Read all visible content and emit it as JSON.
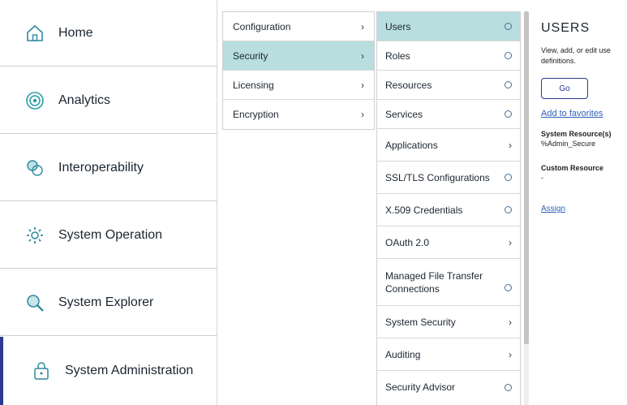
{
  "nav": {
    "items": [
      {
        "label": "Home",
        "icon": "home-icon"
      },
      {
        "label": "Analytics",
        "icon": "analytics-icon"
      },
      {
        "label": "Interoperability",
        "icon": "interoperability-icon"
      },
      {
        "label": "System Operation",
        "icon": "system-operation-icon"
      },
      {
        "label": "System Explorer",
        "icon": "system-explorer-icon"
      },
      {
        "label": "System Administration",
        "icon": "system-administration-icon",
        "active": true
      }
    ],
    "accent": "#2c3b8f"
  },
  "column1": {
    "items": [
      {
        "label": "Configuration"
      },
      {
        "label": "Security",
        "selected": true
      },
      {
        "label": "Licensing"
      },
      {
        "label": "Encryption"
      }
    ]
  },
  "column2": {
    "items": [
      {
        "label": "Users",
        "indicator": "circle",
        "selected": true
      },
      {
        "label": "Roles",
        "indicator": "circle"
      },
      {
        "label": "Resources",
        "indicator": "circle"
      },
      {
        "label": "Services",
        "indicator": "circle"
      },
      {
        "label": "Applications",
        "indicator": "chevron"
      },
      {
        "label": "SSL/TLS Configurations",
        "indicator": "circle"
      },
      {
        "label": "X.509 Credentials",
        "indicator": "circle"
      },
      {
        "label": "OAuth 2.0",
        "indicator": "chevron"
      },
      {
        "label": "Managed File Transfer Connections",
        "indicator": "circle"
      },
      {
        "label": "System Security",
        "indicator": "chevron"
      },
      {
        "label": "Auditing",
        "indicator": "chevron"
      },
      {
        "label": "Security Advisor",
        "indicator": "circle"
      }
    ],
    "selected_color": "#b8dedf"
  },
  "detail": {
    "title": "USERS",
    "description_line1": "View, add, or edit use",
    "description_line2": "definitions.",
    "go_label": "Go",
    "favorites_label": "Add to favorites",
    "system_resource_label": "System Resource(s)",
    "system_resource_value": "%Admin_Secure",
    "custom_resource_label": "Custom Resource",
    "custom_resource_value": "-",
    "assign_label": "Assign"
  }
}
